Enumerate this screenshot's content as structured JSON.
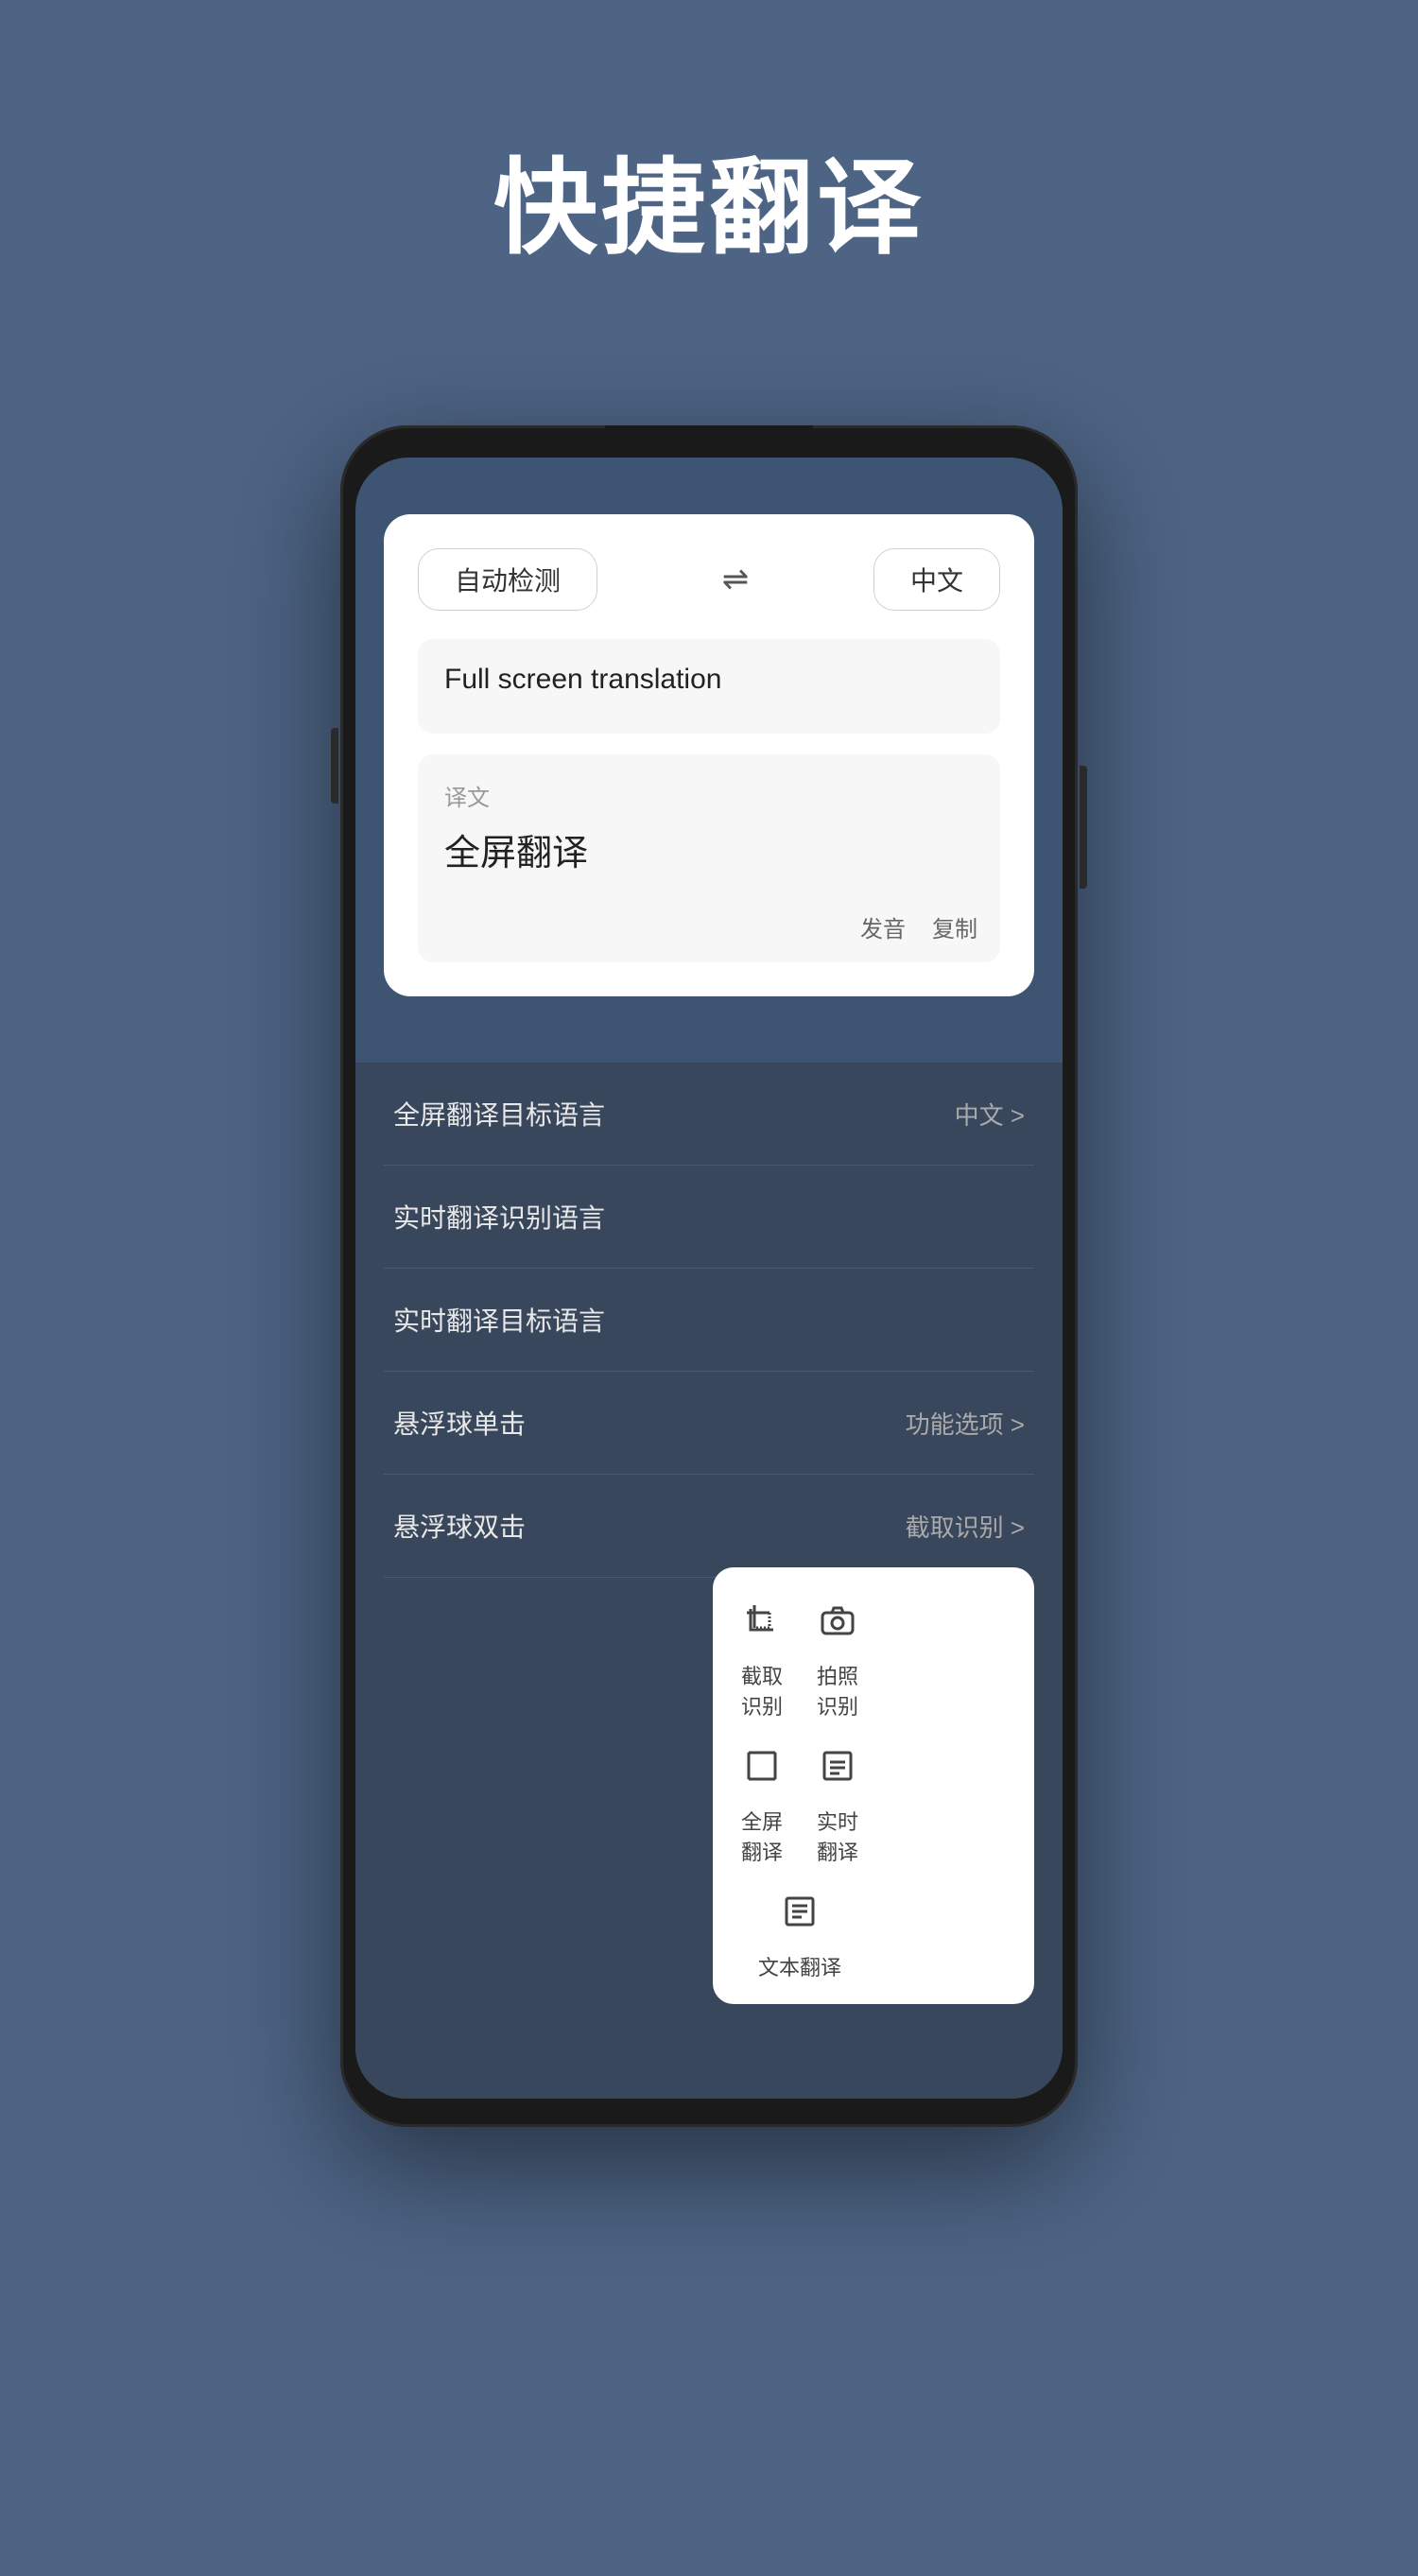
{
  "page": {
    "title": "快捷翻译",
    "background_color": "#4d6484"
  },
  "phone": {
    "screen_bg": "#3d5572"
  },
  "translation_card": {
    "source_lang": "自动检测",
    "target_lang": "中文",
    "swap_symbol": "⇌",
    "input_text": "Full screen translation",
    "output_label": "译文",
    "output_text": "全屏翻译",
    "action_pronounce": "发音",
    "action_copy": "复制"
  },
  "settings": {
    "items": [
      {
        "label": "全屏翻译目标语言",
        "value": "中文 >"
      },
      {
        "label": "实时翻译识别语言",
        "value": ""
      },
      {
        "label": "实时翻译目标语言",
        "value": ""
      },
      {
        "label": "悬浮球单击",
        "value": "功能选项 >"
      },
      {
        "label": "悬浮球双击",
        "value": "截取识别 >"
      }
    ]
  },
  "floating_menu": {
    "items": [
      {
        "id": "crop",
        "icon": "⊡",
        "label": "截取识别"
      },
      {
        "id": "camera",
        "icon": "⊙",
        "label": "拍照识别"
      },
      {
        "id": "fullscreen",
        "icon": "⊞",
        "label": "全屏翻译"
      },
      {
        "id": "realtime",
        "icon": "⊟",
        "label": "实时翻译"
      },
      {
        "id": "text",
        "icon": "≡",
        "label": "文本翻译"
      }
    ]
  }
}
